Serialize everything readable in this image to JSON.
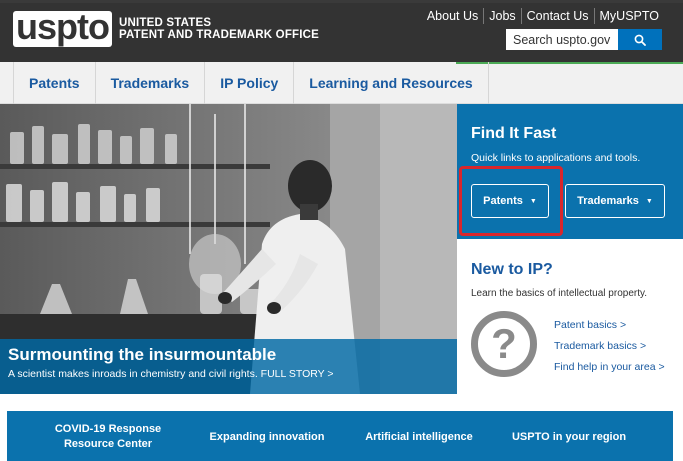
{
  "header": {
    "logo_text": "uspto",
    "office_line1": "UNITED STATES",
    "office_line2": "PATENT AND TRADEMARK OFFICE",
    "util_links": [
      "About Us",
      "Jobs",
      "Contact Us",
      "MyUSPTO"
    ],
    "search": {
      "placeholder": "Search uspto.gov",
      "button_icon": "search-icon"
    }
  },
  "nav": {
    "items": [
      "Patents",
      "Trademarks",
      "IP Policy",
      "Learning and Resources"
    ]
  },
  "hero": {
    "title": "Surmounting the insurmountable",
    "subtitle": "A scientist makes inroads in chemistry and civil rights. FULL STORY >"
  },
  "find_it_fast": {
    "title": "Find It Fast",
    "subtitle": "Quick links to applications and tools.",
    "patents_button": "Patents",
    "trademarks_button": "Trademarks"
  },
  "new_to_ip": {
    "title": "New to IP?",
    "subtitle": "Learn the basics of intellectual property.",
    "icon": "question-icon",
    "links": [
      "Patent basics >",
      "Trademark basics >",
      "Find help in your area >"
    ]
  },
  "band": {
    "item1": "COVID-19 Response Resource Center",
    "item2": "Expanding innovation",
    "item3": "Artificial intelligence",
    "item4": "USPTO in your region"
  },
  "colors": {
    "header_bg": "#333333",
    "brand_blue": "#0b72ad",
    "link_blue": "#1a5aa0",
    "highlight_red": "#d9262c"
  }
}
